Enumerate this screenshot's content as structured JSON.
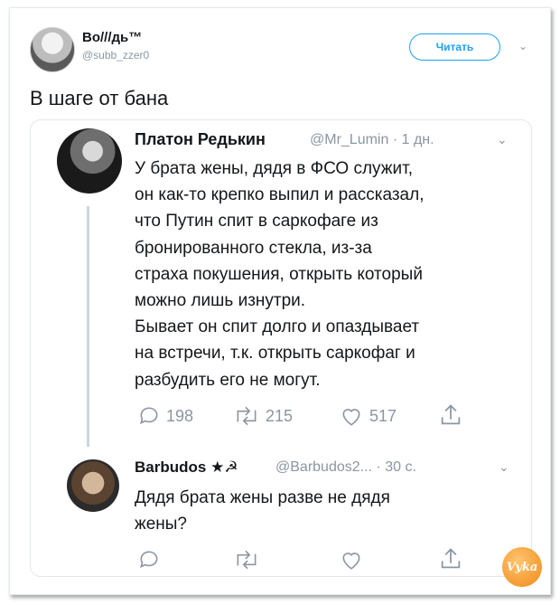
{
  "tweet": {
    "author_name": "Во///дь™",
    "author_handle": "@subb_zzer0",
    "follow_label": "Читать",
    "text": "В шаге от бана"
  },
  "reply1": {
    "name": "Платон Редькин",
    "handle": "@Mr_Lumin",
    "time": "· 1 дн.",
    "lines": [
      "У брата жены, дядя в ФСО служит,",
      "он как-то крепко выпил и рассказал,",
      "что Путин спит в саркофаге из",
      "бронированного стекла, из-за",
      "страха покушения, открыть который",
      "можно лишь изнутри.",
      "Бывает он спит долго и опаздывает",
      "на встречи, т.к. открыть саркофаг и",
      "разбудить его не могут."
    ],
    "replies": "198",
    "retweets": "215",
    "likes": "517"
  },
  "reply2": {
    "name": "Barbudos",
    "emoji": "★☭",
    "handle": "@Barbudos2...",
    "time": "· 30 с.",
    "lines": [
      "Дядя брата жены разве не дядя",
      "жены?"
    ]
  },
  "watermark": "Vyka",
  "colors": {
    "accent": "#1da1f2",
    "muted": "#8a96a3",
    "thread_line": "#ccd6dd"
  }
}
